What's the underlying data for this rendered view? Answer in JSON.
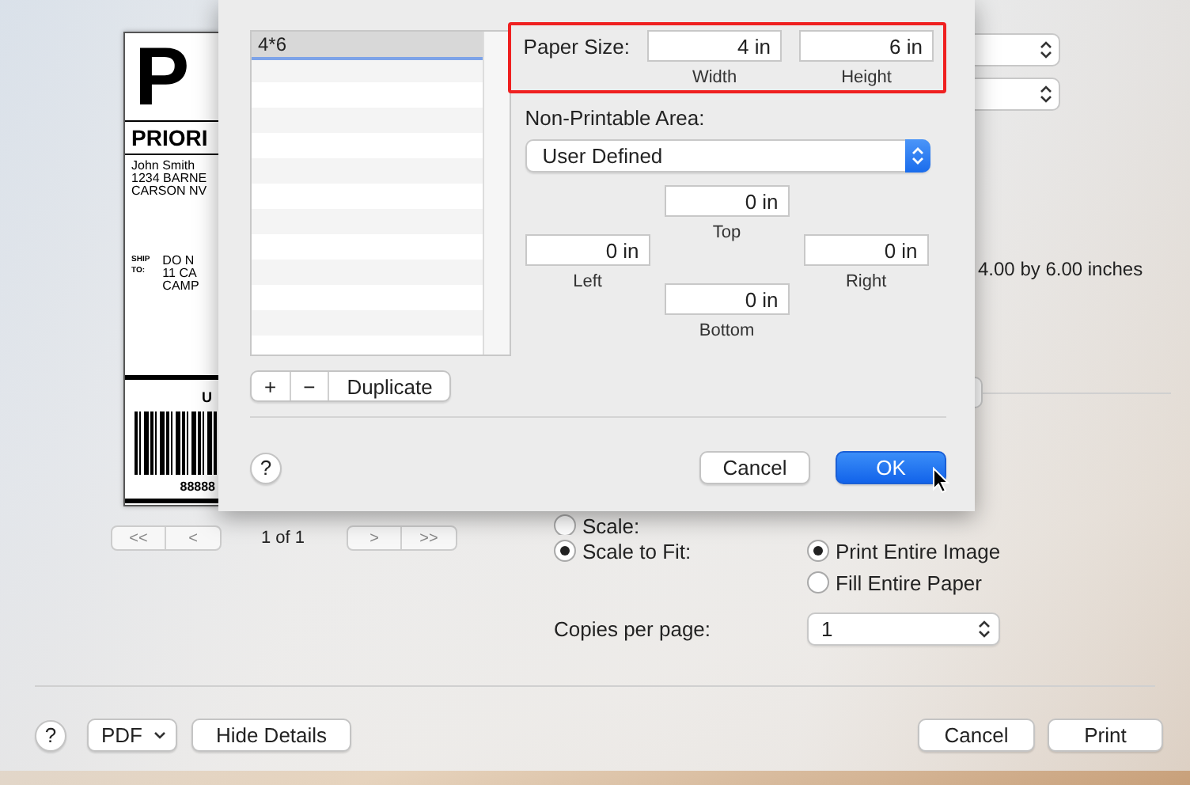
{
  "preview": {
    "big_letter": "P",
    "service": "PRIORI",
    "sender": [
      "John Smith",
      "1234 BARNE",
      "CARSON NV"
    ],
    "ship_to_label": [
      "SHIP",
      "TO:"
    ],
    "recipient": [
      "DO N",
      "11 CA",
      "CAMP"
    ],
    "barcode_title": "U",
    "barcode_number": "88888"
  },
  "pager": {
    "first": "<<",
    "prev": "<",
    "page": "1 of 1",
    "next": ">",
    "last": ">>"
  },
  "paper_info": "4.00 by 6.00 inches",
  "scaling": [
    {
      "label": "Scale:",
      "selected": false
    },
    {
      "label": "Scale to Fit:",
      "selected": true
    }
  ],
  "fit_options": [
    {
      "label": "Print Entire Image",
      "selected": true
    },
    {
      "label": "Fill Entire Paper",
      "selected": false
    }
  ],
  "copies": {
    "label": "Copies per page:",
    "value": "1"
  },
  "footer": {
    "help": "?",
    "pdf": "PDF",
    "details": "Hide Details",
    "buttons": [
      {
        "label": "Cancel",
        "default": false
      },
      {
        "label": "Print",
        "default": false
      }
    ]
  },
  "sheet": {
    "paper_list": [
      {
        "label": "4*6",
        "selected": true
      }
    ],
    "list_buttons": [
      "+",
      "−",
      "Duplicate"
    ],
    "paper_size": {
      "label": "Paper Size:",
      "highlighted": true,
      "fields": [
        {
          "value": "4 in",
          "caption": "Width"
        },
        {
          "value": "6 in",
          "caption": "Height"
        }
      ]
    },
    "non_printable_area": {
      "label": "Non-Printable Area:",
      "popup": "User Defined"
    },
    "margins": [
      {
        "kind": "top",
        "value": "0 in",
        "caption": "Top"
      },
      {
        "kind": "left",
        "value": "0 in",
        "caption": "Left"
      },
      {
        "kind": "right",
        "value": "0 in",
        "caption": "Right"
      },
      {
        "kind": "bottom",
        "value": "0 in",
        "caption": "Bottom"
      }
    ],
    "help": "?",
    "buttons": [
      {
        "label": "Cancel",
        "default": false
      },
      {
        "label": "OK",
        "default": true
      }
    ]
  }
}
